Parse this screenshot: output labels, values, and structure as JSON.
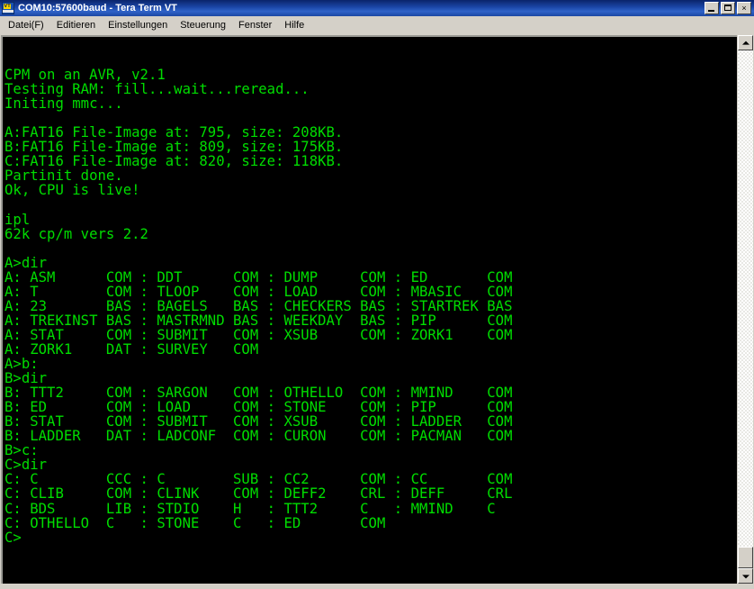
{
  "window": {
    "title": "COM10:57600baud - Tera Term VT",
    "icon": "vt-terminal-icon",
    "icon_label": "VT",
    "minimize_label": "Minimize",
    "maximize_label": "Maximize",
    "close_label": "×",
    "colors": {
      "titlebar": "#0a246a",
      "chrome": "#d4d0c8",
      "terminal_background": "#000000",
      "terminal_text": "#00dd00"
    }
  },
  "menubar": {
    "items": [
      {
        "label": "Datei(F)"
      },
      {
        "label": "Editieren"
      },
      {
        "label": "Einstellungen"
      },
      {
        "label": "Steuerung"
      },
      {
        "label": "Fenster"
      },
      {
        "label": "Hilfe"
      }
    ]
  },
  "terminal": {
    "lines": [
      "",
      "",
      "CPM on an AVR, v2.1",
      "Testing RAM: fill...wait...reread...",
      "Initing mmc...",
      "",
      "A:FAT16 File-Image at: 795, size: 208KB.",
      "B:FAT16 File-Image at: 809, size: 175KB.",
      "C:FAT16 File-Image at: 820, size: 118KB.",
      "Partinit done.",
      "Ok, CPU is live!",
      "",
      "ipl",
      "62k cp/m vers 2.2",
      "",
      "A>dir",
      "A: ASM      COM : DDT      COM : DUMP     COM : ED       COM",
      "A: T        COM : TLOOP    COM : LOAD     COM : MBASIC   COM",
      "A: 23       BAS : BAGELS   BAS : CHECKERS BAS : STARTREK BAS",
      "A: TREKINST BAS : MASTRMND BAS : WEEKDAY  BAS : PIP      COM",
      "A: STAT     COM : SUBMIT   COM : XSUB     COM : ZORK1    COM",
      "A: ZORK1    DAT : SURVEY   COM",
      "A>b:",
      "B>dir",
      "B: TTT2     COM : SARGON   COM : OTHELLO  COM : MMIND    COM",
      "B: ED       COM : LOAD     COM : STONE    COM : PIP      COM",
      "B: STAT     COM : SUBMIT   COM : XSUB     COM : LADDER   COM",
      "B: LADDER   DAT : LADCONF  COM : CURON    COM : PACMAN   COM",
      "B>c:",
      "C>dir",
      "C: C        CCC : C        SUB : CC2      COM : CC       COM",
      "C: CLIB     COM : CLINK    COM : DEFF2    CRL : DEFF     CRL",
      "C: BDS      LIB : STDIO    H   : TTT2     C   : MMIND    C",
      "C: OTHELLO  C   : STONE    C   : ED       COM",
      "C>"
    ]
  },
  "scrollbar": {
    "up_arrow": "scroll-up-arrow",
    "down_arrow": "scroll-down-arrow",
    "thumb": "scroll-thumb",
    "position": "bottom"
  }
}
